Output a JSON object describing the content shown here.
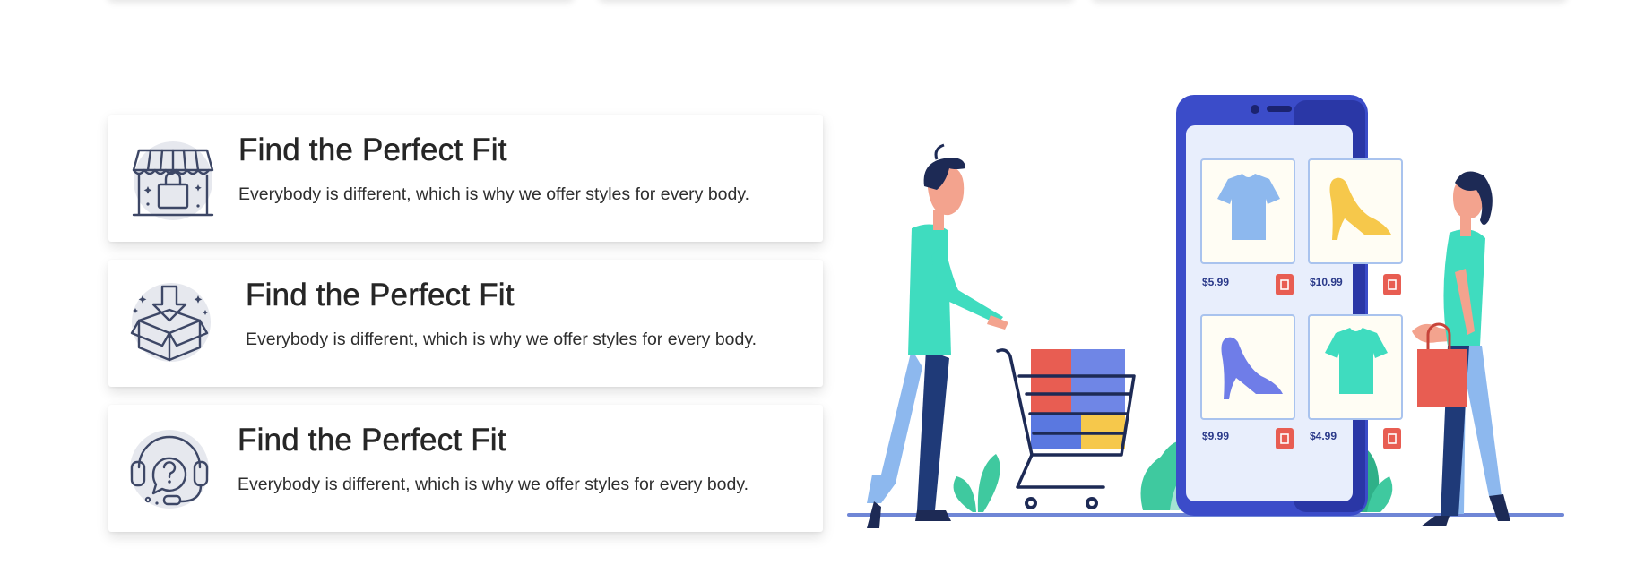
{
  "features": [
    {
      "title": "Find the Perfect Fit",
      "description": "Everybody is different, which is why we offer styles for every body.",
      "icon": "storefront-bag-icon"
    },
    {
      "title": "Find the Perfect Fit",
      "description": "Everybody is different, which is why we offer styles for every body.",
      "icon": "open-box-icon"
    },
    {
      "title": "Find the Perfect Fit",
      "description": "Everybody is different, which is why we offer styles for every body.",
      "icon": "support-headset-icon"
    }
  ],
  "illustration": {
    "products": [
      {
        "price": "$5.99",
        "item": "t-shirt"
      },
      {
        "price": "$10.99",
        "item": "high-heel"
      },
      {
        "price": "$9.99",
        "item": "high-heel"
      },
      {
        "price": "$4.99",
        "item": "t-shirt"
      }
    ]
  },
  "colors": {
    "primary": "#3b4cc9",
    "accent": "#3fdcbf",
    "blob": "#e6e8ee",
    "icon_stroke": "#3d4766"
  }
}
